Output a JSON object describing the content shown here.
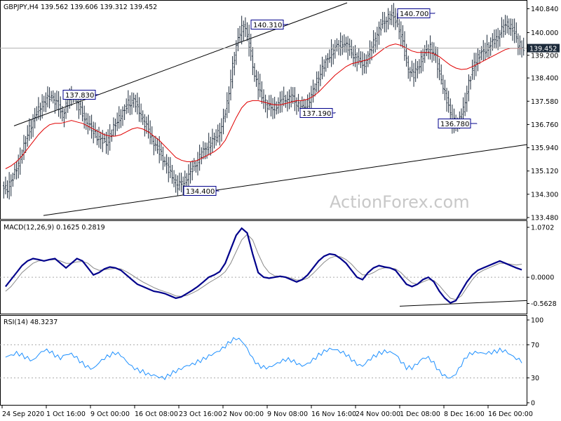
{
  "chart_data": {
    "type": "line",
    "symbol_header": "GBPJPY,H4  139.562 139.606 139.312 139.452",
    "watermark": "ActionForex.com",
    "price_panel": {
      "ylim": [
        133.48,
        141.0
      ],
      "y_ticks": [
        "140.840",
        "140.000",
        "139.200",
        "138.400",
        "137.580",
        "136.760",
        "135.940",
        "135.120",
        "134.300",
        "133.480"
      ],
      "y_tick_values": [
        140.84,
        140.0,
        139.2,
        138.4,
        137.58,
        136.76,
        135.94,
        135.12,
        134.3,
        133.48
      ],
      "current_price": "139.452",
      "current_price_value": 139.452,
      "close_series": [
        134.5,
        134.9,
        135.4,
        136.0,
        136.6,
        137.0,
        137.4,
        137.6,
        137.8,
        137.5,
        137.1,
        137.6,
        137.8,
        137.4,
        137.0,
        136.7,
        136.4,
        136.2,
        136.1,
        136.5,
        136.9,
        137.2,
        137.5,
        137.6,
        137.2,
        136.8,
        136.4,
        136.0,
        135.7,
        135.3,
        134.9,
        134.6,
        134.7,
        135.0,
        135.3,
        135.6,
        135.9,
        136.1,
        136.3,
        136.7,
        137.5,
        138.8,
        139.8,
        140.3,
        139.6,
        138.5,
        137.9,
        137.5,
        137.3,
        137.4,
        137.6,
        137.7,
        137.7,
        137.4,
        137.3,
        137.6,
        138.1,
        138.6,
        139.0,
        139.3,
        139.5,
        139.6,
        139.5,
        139.2,
        139.0,
        138.9,
        139.3,
        139.8,
        140.2,
        140.5,
        140.6,
        140.4,
        139.6,
        138.7,
        138.5,
        138.9,
        139.3,
        139.5,
        139.1,
        138.3,
        137.6,
        136.9,
        136.8,
        137.3,
        138.2,
        138.9,
        139.2,
        139.4,
        139.6,
        139.8,
        140.1,
        140.3,
        140.1,
        139.6,
        139.452
      ],
      "moving_average": [
        135.2,
        135.3,
        135.45,
        135.65,
        135.9,
        136.15,
        136.4,
        136.6,
        136.75,
        136.8,
        136.8,
        136.85,
        136.9,
        136.85,
        136.8,
        136.7,
        136.6,
        136.5,
        136.4,
        136.35,
        136.35,
        136.4,
        136.5,
        136.6,
        136.65,
        136.6,
        136.5,
        136.35,
        136.2,
        136.0,
        135.8,
        135.6,
        135.5,
        135.45,
        135.45,
        135.5,
        135.6,
        135.7,
        135.8,
        135.95,
        136.2,
        136.6,
        137.0,
        137.35,
        137.55,
        137.6,
        137.6,
        137.55,
        137.5,
        137.45,
        137.45,
        137.5,
        137.55,
        137.6,
        137.6,
        137.65,
        137.75,
        137.9,
        138.1,
        138.3,
        138.5,
        138.65,
        138.8,
        138.9,
        138.95,
        139.0,
        139.05,
        139.15,
        139.3,
        139.45,
        139.55,
        139.6,
        139.55,
        139.45,
        139.35,
        139.3,
        139.3,
        139.3,
        139.25,
        139.15,
        139.0,
        138.85,
        138.75,
        138.7,
        138.72,
        138.8,
        138.9,
        139.0,
        139.1,
        139.2,
        139.3,
        139.4,
        139.45,
        139.45,
        139.45
      ],
      "annotations": [
        {
          "label": "137.830",
          "price": 137.83
        },
        {
          "label": "140.310",
          "price": 140.31
        },
        {
          "label": "137.190",
          "price": 137.19
        },
        {
          "label": "140.700",
          "price": 140.7
        },
        {
          "label": "136.780",
          "price": 136.78
        },
        {
          "label": "134.400",
          "price": 134.4
        }
      ]
    },
    "macd_panel": {
      "header": "MACD(12,26,9) 0.1625 0.2819",
      "ylim": [
        -0.72,
        1.1
      ],
      "y_ticks": [
        "1.0702",
        "0.0000",
        "-0.5628"
      ],
      "y_tick_values": [
        1.0702,
        0.0,
        -0.5628
      ],
      "macd_series": [
        -0.2,
        -0.05,
        0.1,
        0.25,
        0.35,
        0.4,
        0.38,
        0.35,
        0.38,
        0.4,
        0.3,
        0.2,
        0.3,
        0.4,
        0.35,
        0.2,
        0.05,
        0.1,
        0.18,
        0.22,
        0.2,
        0.15,
        0.05,
        -0.05,
        -0.15,
        -0.2,
        -0.25,
        -0.3,
        -0.32,
        -0.35,
        -0.4,
        -0.45,
        -0.42,
        -0.35,
        -0.28,
        -0.2,
        -0.1,
        0.0,
        0.05,
        0.12,
        0.3,
        0.6,
        0.9,
        1.05,
        0.95,
        0.5,
        0.1,
        0.0,
        -0.02,
        0.0,
        0.02,
        0.0,
        -0.05,
        -0.1,
        -0.05,
        0.05,
        0.2,
        0.35,
        0.45,
        0.5,
        0.48,
        0.4,
        0.3,
        0.15,
        0.0,
        -0.05,
        0.1,
        0.2,
        0.25,
        0.22,
        0.2,
        0.15,
        0.0,
        -0.15,
        -0.2,
        -0.15,
        -0.05,
        0.0,
        -0.1,
        -0.3,
        -0.45,
        -0.55,
        -0.5,
        -0.3,
        -0.1,
        0.05,
        0.15,
        0.2,
        0.25,
        0.3,
        0.35,
        0.3,
        0.25,
        0.2,
        0.16
      ],
      "signal_series": [
        -0.3,
        -0.2,
        -0.05,
        0.1,
        0.2,
        0.3,
        0.35,
        0.36,
        0.37,
        0.38,
        0.35,
        0.3,
        0.3,
        0.33,
        0.34,
        0.3,
        0.2,
        0.15,
        0.16,
        0.18,
        0.19,
        0.18,
        0.12,
        0.05,
        -0.03,
        -0.1,
        -0.16,
        -0.22,
        -0.27,
        -0.31,
        -0.35,
        -0.4,
        -0.41,
        -0.39,
        -0.34,
        -0.28,
        -0.2,
        -0.12,
        -0.05,
        0.02,
        0.12,
        0.3,
        0.55,
        0.8,
        0.92,
        0.8,
        0.5,
        0.25,
        0.1,
        0.03,
        0.02,
        0.01,
        -0.02,
        -0.06,
        -0.06,
        -0.02,
        0.08,
        0.2,
        0.32,
        0.41,
        0.45,
        0.44,
        0.38,
        0.28,
        0.15,
        0.05,
        0.05,
        0.1,
        0.17,
        0.2,
        0.2,
        0.18,
        0.1,
        -0.02,
        -0.12,
        -0.15,
        -0.1,
        -0.05,
        -0.07,
        -0.18,
        -0.32,
        -0.45,
        -0.48,
        -0.4,
        -0.22,
        -0.05,
        0.08,
        0.15,
        0.2,
        0.25,
        0.3,
        0.3,
        0.28,
        0.26,
        0.28
      ]
    },
    "rsi_panel": {
      "header": "RSI(14) 48.3237",
      "ylim": [
        0,
        100
      ],
      "y_ticks": [
        "100",
        "70",
        "30",
        "0"
      ],
      "y_tick_values": [
        100,
        70,
        30,
        0
      ],
      "rsi_series": [
        55,
        58,
        62,
        60,
        56,
        52,
        58,
        62,
        60,
        55,
        52,
        58,
        60,
        56,
        50,
        45,
        42,
        48,
        52,
        55,
        58,
        56,
        50,
        45,
        42,
        40,
        36,
        34,
        30,
        28,
        32,
        36,
        40,
        45,
        48,
        52,
        55,
        58,
        60,
        62,
        66,
        72,
        76,
        74,
        66,
        55,
        48,
        45,
        44,
        46,
        48,
        50,
        49,
        46,
        44,
        48,
        54,
        60,
        64,
        66,
        64,
        60,
        56,
        50,
        45,
        44,
        52,
        58,
        62,
        64,
        62,
        58,
        48,
        40,
        40,
        46,
        54,
        56,
        50,
        40,
        34,
        30,
        34,
        44,
        54,
        58,
        60,
        60,
        62,
        64,
        66,
        64,
        58,
        52,
        48
      ]
    },
    "x_labels": [
      "24 Sep 2020",
      "1 Oct 16:00",
      "9 Oct 00:00",
      "16 Oct 08:00",
      "23 Oct 16:00",
      "2 Nov 00:00",
      "9 Nov 08:00",
      "16 Nov 16:00",
      "24 Nov 00:00",
      "1 Dec 08:00",
      "8 Dec 16:00",
      "16 Dec 00:00"
    ],
    "colors": {
      "price": "#1c2a3a",
      "moving_average": "#e00000",
      "macd": "#00008b",
      "signal": "#8a8a8a",
      "rsi": "#1e90ff",
      "channel": "#000000",
      "label_border": "#00008b",
      "current_price_bg": "#1c2a3a"
    }
  }
}
